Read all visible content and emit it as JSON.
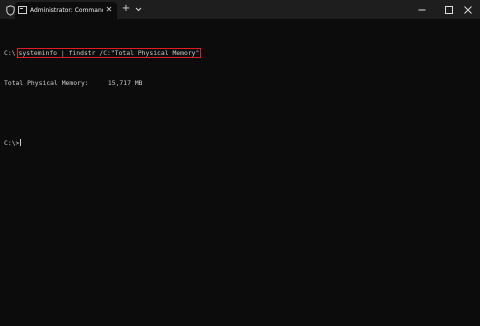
{
  "window": {
    "tab_title": "Administrator: Command Prompt",
    "tab_close_glyph": "✕",
    "new_tab_glyph": "+",
    "icons": {
      "shield": "shield-icon",
      "tab": "terminal-icon",
      "dropdown": "chevron-down-icon",
      "minimize": "minimize-icon",
      "maximize": "maximize-icon",
      "close": "close-icon"
    }
  },
  "terminal": {
    "prompt1": "C:\\",
    "command": "systeminfo | findstr /C:\"Total Physical Memory\"",
    "output": "Total Physical Memory:     15,717 MB",
    "prompt2": "C:\\>",
    "colors": {
      "background": "#0c0c0c",
      "text": "#cccccc",
      "highlight": "#e01b24"
    }
  }
}
